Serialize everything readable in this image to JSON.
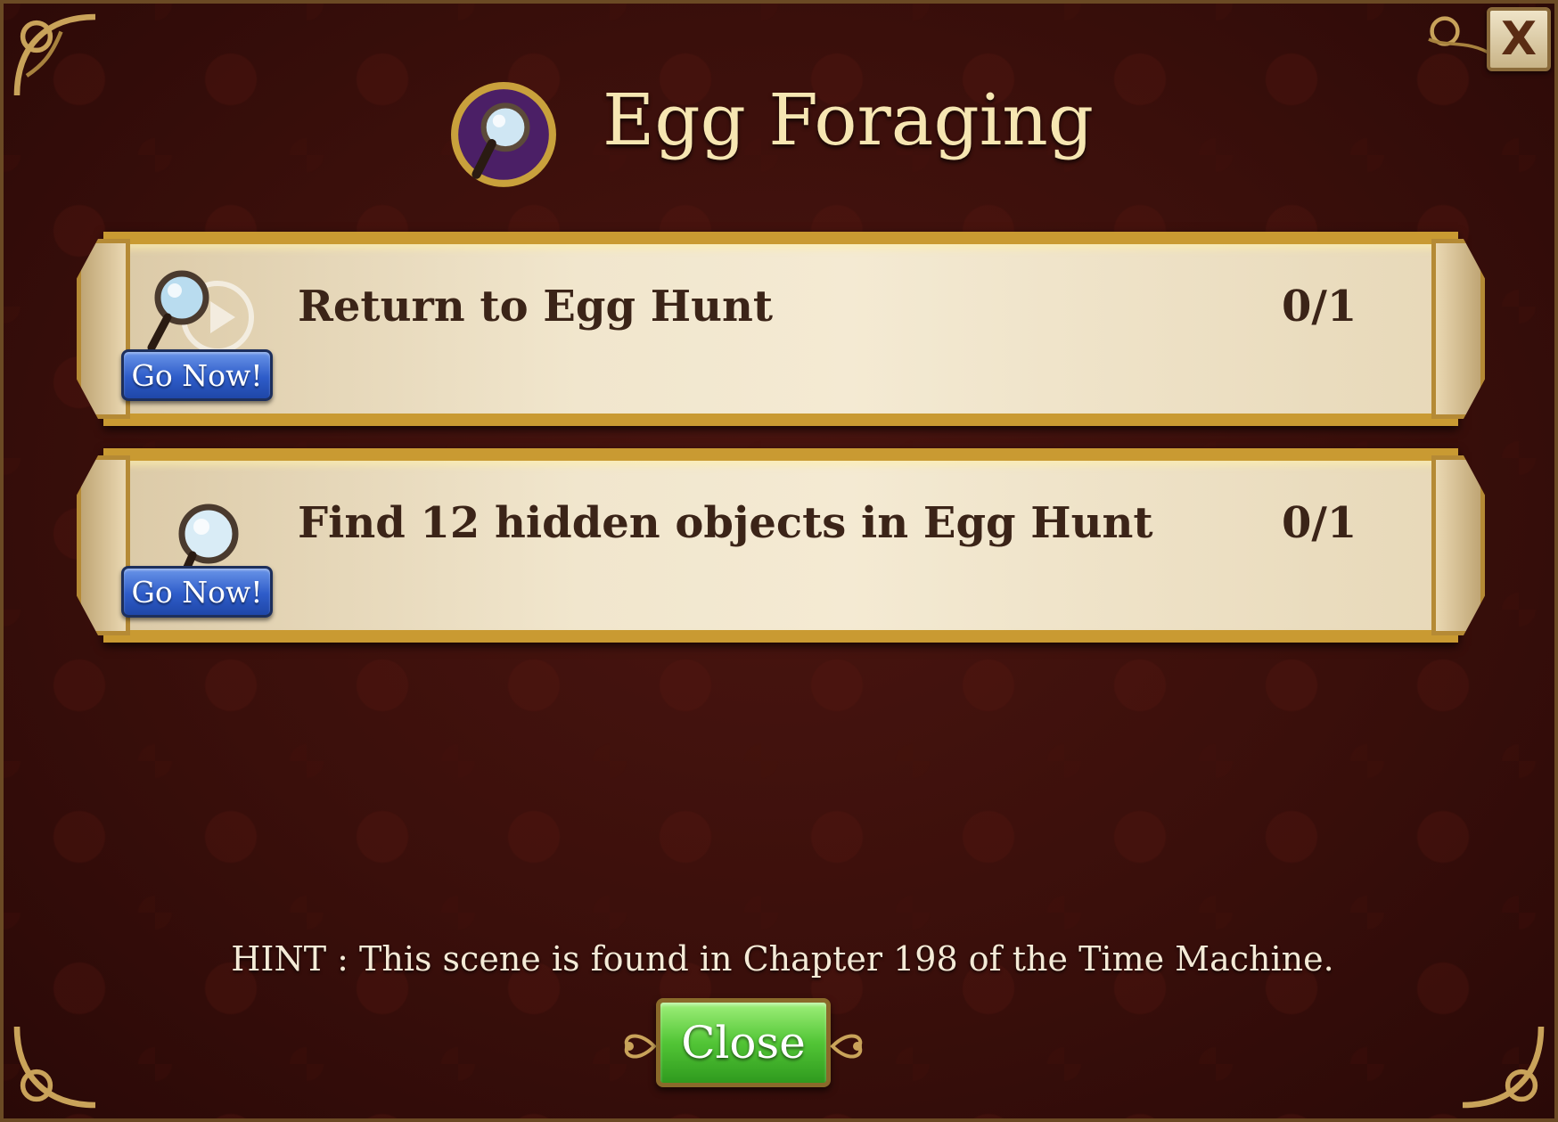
{
  "dialog": {
    "title": "Egg Foraging",
    "close_x_label": "X"
  },
  "tasks": [
    {
      "label": "Return to Egg Hunt",
      "progress": "0/1",
      "button_label": "Go Now!"
    },
    {
      "label": "Find 12 hidden objects in Egg Hunt",
      "progress": "0/1",
      "button_label": "Go Now!"
    }
  ],
  "hint": "HINT : This scene is found in Chapter 198 of the Time Machine.",
  "footer": {
    "close_label": "Close"
  },
  "colors": {
    "background": "#3a0f0b",
    "title_text": "#f6e6b2",
    "go_button": "#2e5cc9",
    "close_button": "#52c536",
    "gold_trim": "#c99a32"
  }
}
